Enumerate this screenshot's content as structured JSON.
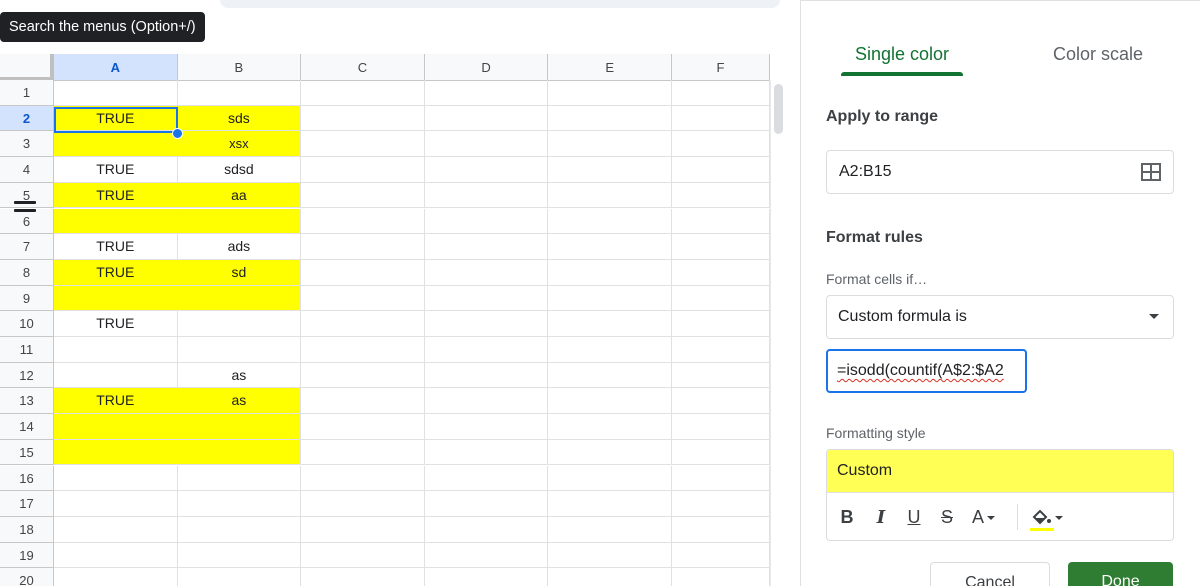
{
  "tooltip": {
    "text": "Search the menus (Option+/)"
  },
  "columns": [
    "A",
    "B",
    "C",
    "D",
    "E",
    "F"
  ],
  "selected_column": "A",
  "selected_row": 2,
  "rows": [
    {
      "num": "1",
      "a": "",
      "b": "",
      "highlight": false
    },
    {
      "num": "2",
      "a": "TRUE",
      "b": "sds",
      "highlight": true
    },
    {
      "num": "3",
      "a": "",
      "b": "xsx",
      "highlight": true
    },
    {
      "num": "4",
      "a": "TRUE",
      "b": "sdsd",
      "highlight": false
    },
    {
      "num": "5",
      "a": "TRUE",
      "b": "aa",
      "highlight": true
    },
    {
      "num": "6",
      "a": "",
      "b": "",
      "highlight": true
    },
    {
      "num": "7",
      "a": "TRUE",
      "b": "ads",
      "highlight": false
    },
    {
      "num": "8",
      "a": "TRUE",
      "b": "sd",
      "highlight": true
    },
    {
      "num": "9",
      "a": "",
      "b": "",
      "highlight": true
    },
    {
      "num": "10",
      "a": "TRUE",
      "b": "",
      "highlight": false
    },
    {
      "num": "11",
      "a": "",
      "b": "",
      "highlight": false
    },
    {
      "num": "12",
      "a": "",
      "b": "as",
      "highlight": false
    },
    {
      "num": "13",
      "a": "TRUE",
      "b": "as",
      "highlight": true
    },
    {
      "num": "14",
      "a": "",
      "b": "",
      "highlight": true
    },
    {
      "num": "15",
      "a": "",
      "b": "",
      "highlight": true
    },
    {
      "num": "16",
      "a": "",
      "b": "",
      "highlight": false
    },
    {
      "num": "17",
      "a": "",
      "b": "",
      "highlight": false
    },
    {
      "num": "18",
      "a": "",
      "b": "",
      "highlight": false
    },
    {
      "num": "19",
      "a": "",
      "b": "",
      "highlight": false
    },
    {
      "num": "20",
      "a": "",
      "b": "",
      "highlight": false
    }
  ],
  "colors": {
    "highlight": "#ffff00",
    "accent_green": "#137333",
    "selection_blue": "#1a73e8",
    "preview_yellow": "#ffff55",
    "done_green": "#2e7d32"
  },
  "panel": {
    "tabs": [
      {
        "label": "Single color",
        "active": true
      },
      {
        "label": "Color scale",
        "active": false
      }
    ],
    "apply_to_range": {
      "label": "Apply to range",
      "value": "A2:B15",
      "icon": "grid-select-icon"
    },
    "format_rules": {
      "heading": "Format rules",
      "condition_label": "Format cells if…",
      "condition_value": "Custom formula is",
      "formula_value": "=isodd(countif(A$2:$A2"
    },
    "formatting_style": {
      "label": "Formatting style",
      "preview_text": "Custom",
      "toolbar": {
        "bold": "B",
        "italic": "I",
        "underline": "U",
        "strikethrough": "S",
        "text_color": "A",
        "fill_color_icon": "paint-bucket-icon"
      }
    },
    "buttons": {
      "cancel": "Cancel",
      "done": "Done"
    }
  }
}
